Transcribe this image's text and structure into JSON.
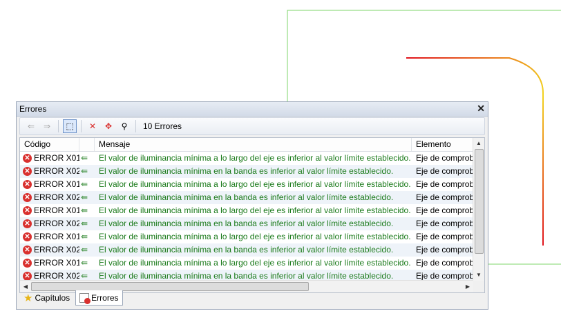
{
  "panel": {
    "title": "Errores",
    "close_glyph": "✕",
    "toolbar": {
      "count_label": "10 Errores",
      "buttons": [
        {
          "name": "prev-error-button",
          "icon": "doc-back-icon",
          "glyph": "⇐",
          "state": "disabled"
        },
        {
          "name": "next-error-button",
          "icon": "doc-forward-icon",
          "glyph": "⇒",
          "state": "disabled"
        },
        {
          "name": "select-area-button",
          "icon": "selection-icon",
          "glyph": "⬚",
          "state": "pressed"
        },
        {
          "name": "delete-button",
          "icon": "red-x-icon",
          "glyph": "✕",
          "state": "normal"
        },
        {
          "name": "center-view-button",
          "icon": "target-icon",
          "glyph": "✥",
          "state": "normal"
        },
        {
          "name": "zoom-button",
          "icon": "magnifier-icon",
          "glyph": "⚲",
          "state": "normal"
        }
      ]
    },
    "columns": [
      "Código",
      "",
      "Mensaje",
      "Elemento"
    ],
    "rows": [
      {
        "code": "ERROR X01",
        "message": "El valor de iluminancia mínima a lo largo del eje es inferior al valor límite establecido.",
        "element": "Eje de comprob"
      },
      {
        "code": "ERROR X02",
        "message": "El valor de iluminancia mínima en la banda es inferior al valor límite establecido.",
        "element": "Eje de comprob"
      },
      {
        "code": "ERROR X01",
        "message": "El valor de iluminancia mínima a lo largo del eje es inferior al valor límite establecido.",
        "element": "Eje de comprob"
      },
      {
        "code": "ERROR X02",
        "message": "El valor de iluminancia mínima en la banda es inferior al valor límite establecido.",
        "element": "Eje de comprob"
      },
      {
        "code": "ERROR X01",
        "message": "El valor de iluminancia mínima a lo largo del eje es inferior al valor límite establecido.",
        "element": "Eje de comprob"
      },
      {
        "code": "ERROR X02",
        "message": "El valor de iluminancia mínima en la banda es inferior al valor límite establecido.",
        "element": "Eje de comprob"
      },
      {
        "code": "ERROR X01",
        "message": "El valor de iluminancia mínima a lo largo del eje es inferior al valor límite establecido.",
        "element": "Eje de comprob"
      },
      {
        "code": "ERROR X02",
        "message": "El valor de iluminancia mínima en la banda es inferior al valor límite establecido.",
        "element": "Eje de comprob"
      },
      {
        "code": "ERROR X01",
        "message": "El valor de iluminancia mínima a lo largo del eje es inferior al valor límite establecido.",
        "element": "Eje de comprob"
      },
      {
        "code": "ERROR X02",
        "message": "El valor de iluminancia mínima en la banda es inferior al valor límite establecido.",
        "element": "Eje de comprob"
      }
    ],
    "tabs": [
      {
        "label": "Capítulos",
        "icon": "star-icon",
        "active": false
      },
      {
        "label": "Errores",
        "icon": "error-document-icon",
        "active": true
      }
    ]
  },
  "colors": {
    "message_text": "#1a7a1a",
    "error_icon": "#d9302e",
    "canvas_outline": "#7cd46a",
    "path_gradient_start": "#e0111b",
    "path_gradient_end": "#f2d21c"
  }
}
